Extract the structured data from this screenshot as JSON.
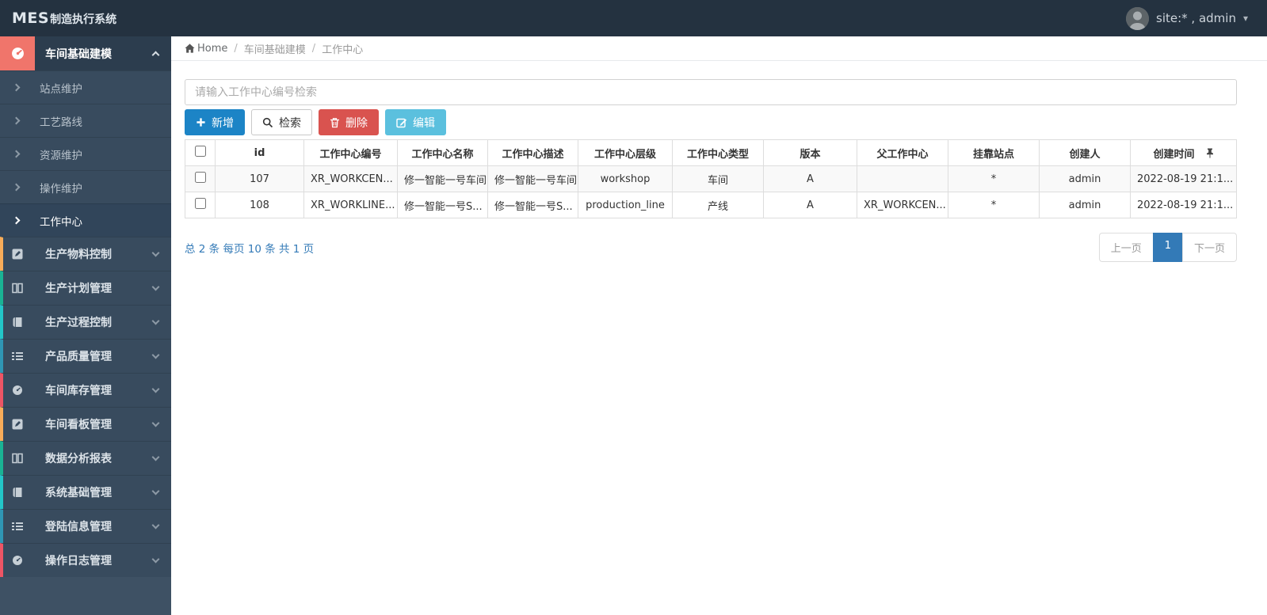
{
  "navbar": {
    "brand_bold": "MES",
    "brand_rest": "制造执行系统",
    "user_label": "site:* , admin",
    "caret": "▾"
  },
  "breadcrumb": {
    "home": "Home",
    "separator": "/",
    "section": "车间基础建模",
    "current": "工作中心"
  },
  "sidebar": {
    "active_group": {
      "label": "车间基础建模",
      "icon": "dashboard-icon",
      "accent": "#f0756b"
    },
    "sub_items": [
      {
        "label": "站点维护"
      },
      {
        "label": "工艺路线"
      },
      {
        "label": "资源维护"
      },
      {
        "label": "操作维护"
      },
      {
        "label": "工作中心"
      }
    ],
    "groups": [
      {
        "label": "生产物料控制",
        "icon": "edit-icon",
        "strip_style": "border-left-color:#f8ac59"
      },
      {
        "label": "生产计划管理",
        "icon": "columns-icon",
        "strip_style": "border-left-color:#1ab394"
      },
      {
        "label": "生产过程控制",
        "icon": "book-icon",
        "strip_style": "border-left-color:#23c6c8"
      },
      {
        "label": "产品质量管理",
        "icon": "list-icon",
        "strip_style": "border-left-color:#2f96b4"
      },
      {
        "label": "车间库存管理",
        "icon": "dashboard-icon",
        "strip_style": "border-left-color:#ed5565"
      },
      {
        "label": "车间看板管理",
        "icon": "edit-icon",
        "strip_style": "border-left-color:#f8ac59"
      },
      {
        "label": "数据分析报表",
        "icon": "columns-icon",
        "strip_style": "border-left-color:#1ab394"
      },
      {
        "label": "系统基础管理",
        "icon": "book-icon",
        "strip_style": "border-left-color:#23c6c8"
      },
      {
        "label": "登陆信息管理",
        "icon": "list-icon",
        "strip_style": "border-left-color:#2f96b4"
      },
      {
        "label": "操作日志管理",
        "icon": "dashboard-icon",
        "strip_style": "border-left-color:#ed5565"
      }
    ]
  },
  "toolbar": {
    "search_placeholder": "请输入工作中心编号检索",
    "buttons": [
      {
        "label": "新增",
        "icon": "plus-icon",
        "color": "#1c84c6"
      },
      {
        "label": "检索",
        "icon": "search-icon",
        "color": "#ffffff"
      },
      {
        "label": "删除",
        "icon": "trash-icon",
        "color": "#d9534f"
      },
      {
        "label": "编辑",
        "icon": "edit-icon",
        "color": "#5bc0de"
      }
    ]
  },
  "table": {
    "columns": [
      "id",
      "工作中心编号",
      "工作中心名称",
      "工作中心描述",
      "工作中心层级",
      "工作中心类型",
      "版本",
      "父工作中心",
      "挂靠站点",
      "创建人",
      "创建时间"
    ],
    "rows": [
      [
        "107",
        "XR_WORKCEN...",
        "修一智能一号车间",
        "修一智能一号车间",
        "workshop",
        "车间",
        "A",
        "",
        "*",
        "admin",
        "2022-08-19 21:1..."
      ],
      [
        "108",
        "XR_WORKLINE...",
        "修一智能一号S...",
        "修一智能一号S...",
        "production_line",
        "产线",
        "A",
        "XR_WORKCEN...",
        "*",
        "admin",
        "2022-08-19 21:1..."
      ]
    ]
  },
  "pagination": {
    "summary": "总 2 条 每页 10 条 共 1 页",
    "prev": "上一页",
    "current_page": "1",
    "next": "下一页"
  },
  "theme": {
    "navbar_bg": "#243240",
    "sidebar_bg": "#3e5164",
    "active_item_bg": "#2c3d4e",
    "accent_salmon": "#f0756b",
    "primary_blue": "#1c84c6",
    "danger_red": "#d9534f",
    "info_cyan": "#5bc0de",
    "link_blue": "#337ab7"
  }
}
